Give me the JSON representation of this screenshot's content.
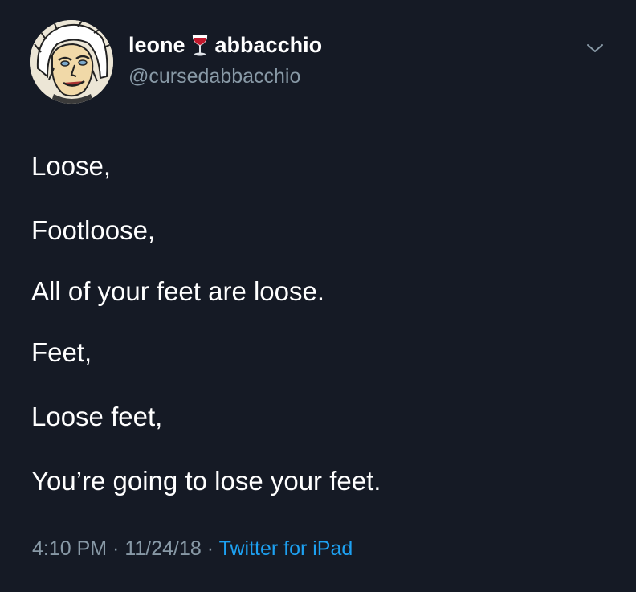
{
  "author": {
    "display_name_first": "leone",
    "display_name_second": "abbacchio",
    "handle": "@cursedabbacchio",
    "name_emoji_icon": "wine-glass-icon"
  },
  "menu_icon": "chevron-down-icon",
  "tweet": {
    "lines": [
      "Loose,",
      "Footloose,",
      "All of your feet are loose.",
      "Feet,",
      "Loose feet,",
      "You’re going to lose your feet."
    ]
  },
  "meta": {
    "time": "4:10 PM",
    "separator": " · ",
    "date": "11/24/18",
    "source": "Twitter for iPad"
  },
  "colors": {
    "background": "#151a25",
    "text": "#ffffff",
    "secondary_text": "#8899a6",
    "link": "#1da1f2"
  }
}
